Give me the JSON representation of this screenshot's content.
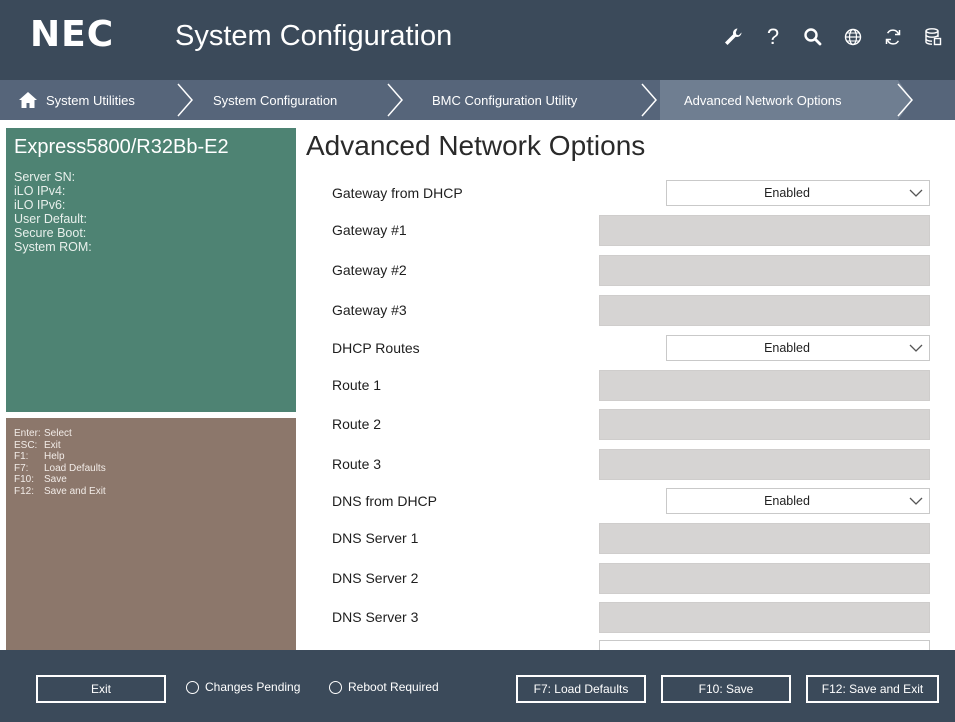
{
  "header": {
    "logo": "NEC",
    "title": "System Configuration",
    "icons": [
      "wrench-icon",
      "help-icon",
      "search-icon",
      "globe-icon",
      "refresh-icon",
      "database-icon"
    ]
  },
  "breadcrumb": {
    "items": [
      {
        "label": "System Utilities"
      },
      {
        "label": "System Configuration"
      },
      {
        "label": "BMC Configuration Utility"
      },
      {
        "label": "Advanced Network Options"
      }
    ]
  },
  "sidebar": {
    "model": "Express5800/R32Bb-E2",
    "info": [
      "Server SN:",
      "iLO IPv4:",
      "iLO IPv6:",
      "User Default:",
      "Secure Boot:",
      "System ROM:"
    ],
    "keys": [
      {
        "key": "Enter:",
        "action": "Select"
      },
      {
        "key": "ESC:",
        "action": "Exit"
      },
      {
        "key": "F1:",
        "action": "Help"
      },
      {
        "key": "F7:",
        "action": "Load Defaults"
      },
      {
        "key": "F10:",
        "action": "Save"
      },
      {
        "key": "F12:",
        "action": "Save and Exit"
      }
    ]
  },
  "main": {
    "title": "Advanced Network Options",
    "fields": [
      {
        "label": "Gateway from DHCP",
        "type": "select",
        "value": "Enabled"
      },
      {
        "label": "Gateway #1",
        "type": "text",
        "value": ""
      },
      {
        "label": "Gateway #2",
        "type": "text",
        "value": ""
      },
      {
        "label": "Gateway #3",
        "type": "text",
        "value": ""
      },
      {
        "label": "DHCP Routes",
        "type": "select",
        "value": "Enabled"
      },
      {
        "label": "Route 1",
        "type": "text",
        "value": ""
      },
      {
        "label": "Route 2",
        "type": "text",
        "value": ""
      },
      {
        "label": "Route 3",
        "type": "text",
        "value": ""
      },
      {
        "label": "DNS from DHCP",
        "type": "select",
        "value": "Enabled"
      },
      {
        "label": "DNS Server 1",
        "type": "text",
        "value": ""
      },
      {
        "label": "DNS Server 2",
        "type": "text",
        "value": ""
      },
      {
        "label": "DNS Server 3",
        "type": "text",
        "value": ""
      }
    ]
  },
  "footer": {
    "exit_label": "Exit",
    "changes_pending": "Changes Pending",
    "reboot_required": "Reboot Required",
    "f7_label": "F7: Load Defaults",
    "f10_label": "F10: Save",
    "f12_label": "F12: Save and Exit"
  },
  "colors": {
    "header_bg": "#3b4a5a",
    "breadcrumb_bg": "#56657a",
    "info_panel": "#4e8373",
    "keys_panel": "#8c776b",
    "text_field_bg": "#d6d4d3"
  }
}
